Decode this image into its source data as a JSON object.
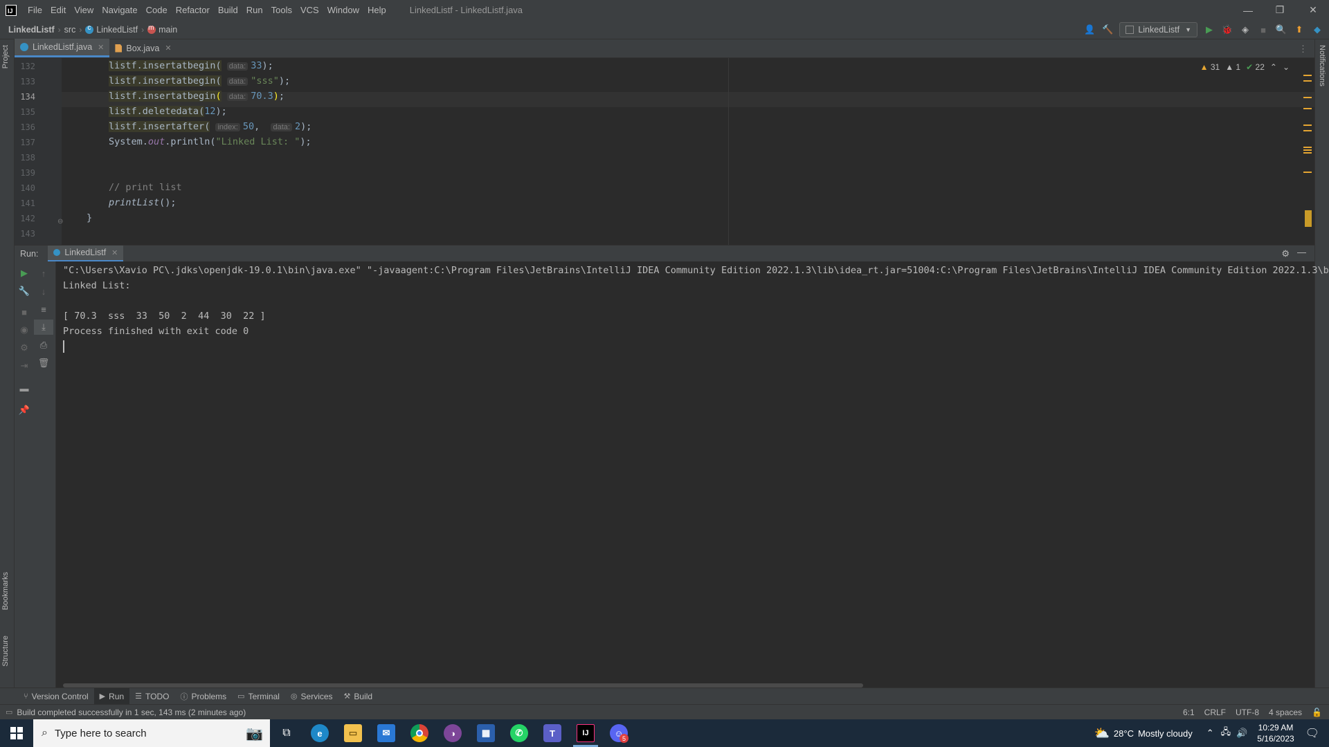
{
  "window": {
    "title": "LinkedListf - LinkedListf.java",
    "menu": [
      "File",
      "Edit",
      "View",
      "Navigate",
      "Code",
      "Refactor",
      "Build",
      "Run",
      "Tools",
      "VCS",
      "Window",
      "Help"
    ]
  },
  "breadcrumbs": [
    "LinkedListf",
    "src",
    "LinkedListf",
    "main"
  ],
  "run_config": "LinkedListf",
  "tool_strip": {
    "project": "Project",
    "bookmarks": "Bookmarks",
    "structure": "Structure",
    "notifications": "Notifications"
  },
  "editor_tabs": [
    {
      "label": "LinkedListf.java",
      "active": true
    },
    {
      "label": "Box.java",
      "active": false
    }
  ],
  "inspections": {
    "warnings": "31",
    "weak_warnings": "1",
    "ok": "22"
  },
  "code": {
    "line_numbers": [
      "132",
      "133",
      "134",
      "135",
      "136",
      "137",
      "138",
      "139",
      "140",
      "141",
      "142",
      "143"
    ],
    "current_line": "134",
    "lines": [
      {
        "obj": "listf",
        "method": "insertatbegin",
        "hint": "data:",
        "arg": "33",
        "tail": ");"
      },
      {
        "obj": "listf",
        "method": "insertatbegin",
        "hint": "data:",
        "arg": "\"sss\"",
        "tail": ");"
      },
      {
        "obj": "listf",
        "method": "insertatbegin",
        "hint": "data:",
        "arg": "70.3",
        "tail": ");"
      },
      {
        "obj": "listf",
        "method": "deletedata",
        "arg": "12",
        "tail": ");"
      },
      {
        "obj": "listf",
        "method": "insertafter",
        "hint1": "index:",
        "arg1": "50",
        "hint2": "data:",
        "arg2": "2",
        "tail": ");"
      },
      {
        "prefix": "System.",
        "field": "out",
        "call": ".println(",
        "str": "\"Linked List: \"",
        "tail": ");"
      },
      {
        "comment": "// print list"
      },
      {
        "call": "printList",
        "tail": "();"
      },
      {
        "brace": "}"
      }
    ]
  },
  "run_panel": {
    "label": "Run:",
    "tab": "LinkedListf",
    "console": [
      "\"C:\\Users\\Xavio PC\\.jdks\\openjdk-19.0.1\\bin\\java.exe\" \"-javaagent:C:\\Program Files\\JetBrains\\IntelliJ IDEA Community Edition 2022.1.3\\lib\\idea_rt.jar=51004:C:\\Program Files\\JetBrains\\IntelliJ IDEA Community Edition 2022.1.3\\bi",
      "Linked List:",
      "",
      "[ 70.3  sss  33  50  2  44  30  22 ]",
      "Process finished with exit code 0"
    ]
  },
  "bottom_tabs": [
    "Version Control",
    "Run",
    "TODO",
    "Problems",
    "Terminal",
    "Services",
    "Build"
  ],
  "status": {
    "message": "Build completed successfully in 1 sec, 143 ms (2 minutes ago)",
    "position": "6:1",
    "line_sep": "CRLF",
    "encoding": "UTF-8",
    "indent": "4 spaces"
  },
  "taskbar": {
    "search_placeholder": "Type here to search",
    "weather_temp": "28°C",
    "weather_desc": "Mostly cloudy",
    "time": "10:29 AM",
    "date": "5/16/2023",
    "discord_badge": "5"
  },
  "colors": {
    "accent": "#4a88c7",
    "run_green": "#499c54",
    "warning": "#e6a632"
  }
}
